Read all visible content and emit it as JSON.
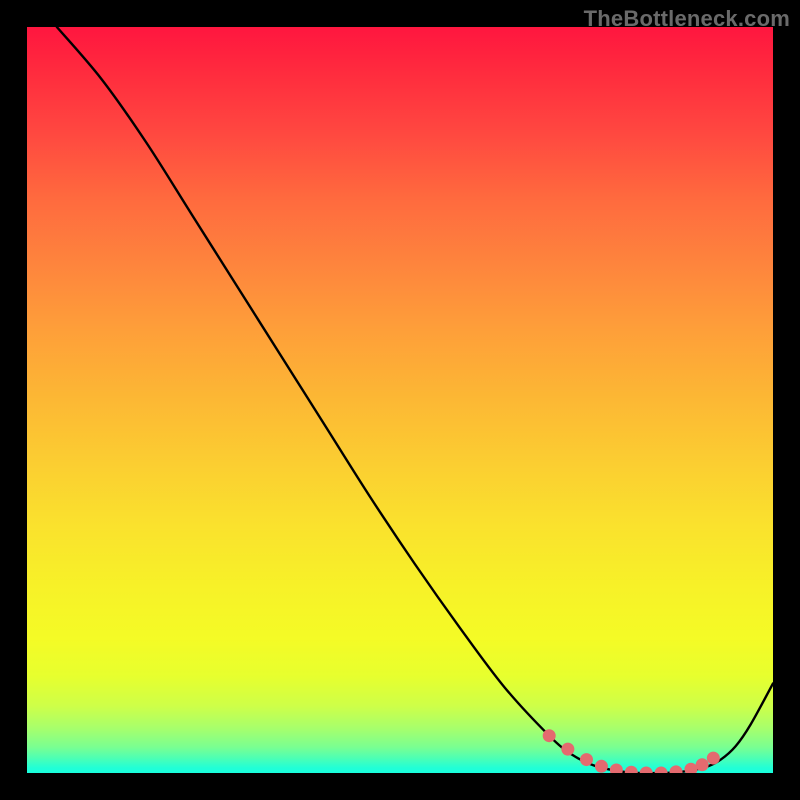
{
  "watermark": "TheBottleneck.com",
  "chart_data": {
    "type": "line",
    "title": "",
    "xlabel": "",
    "ylabel": "",
    "xlim": [
      0,
      100
    ],
    "ylim": [
      0,
      100
    ],
    "series": [
      {
        "name": "bottleneck-curve",
        "x": [
          4,
          10,
          16,
          22,
          28,
          34,
          40,
          46,
          52,
          58,
          64,
          70,
          73,
          76,
          79,
          82,
          85,
          88,
          91,
          93,
          95,
          97,
          100
        ],
        "values": [
          100,
          93,
          84.5,
          75,
          65.5,
          56,
          46.5,
          37,
          28,
          19.5,
          11.5,
          5,
          2.5,
          1,
          0.3,
          0,
          0,
          0.2,
          0.8,
          1.8,
          3.6,
          6.5,
          12
        ]
      }
    ],
    "highlight": {
      "name": "valley-dots",
      "color": "#e46a6f",
      "x": [
        70,
        72.5,
        75,
        77,
        79,
        81,
        83,
        85,
        87,
        89,
        90.5,
        92
      ],
      "values": [
        5,
        3.2,
        1.8,
        0.9,
        0.4,
        0.1,
        0,
        0,
        0.15,
        0.5,
        1.1,
        2
      ]
    },
    "background": "rainbow-vertical-gradient"
  }
}
